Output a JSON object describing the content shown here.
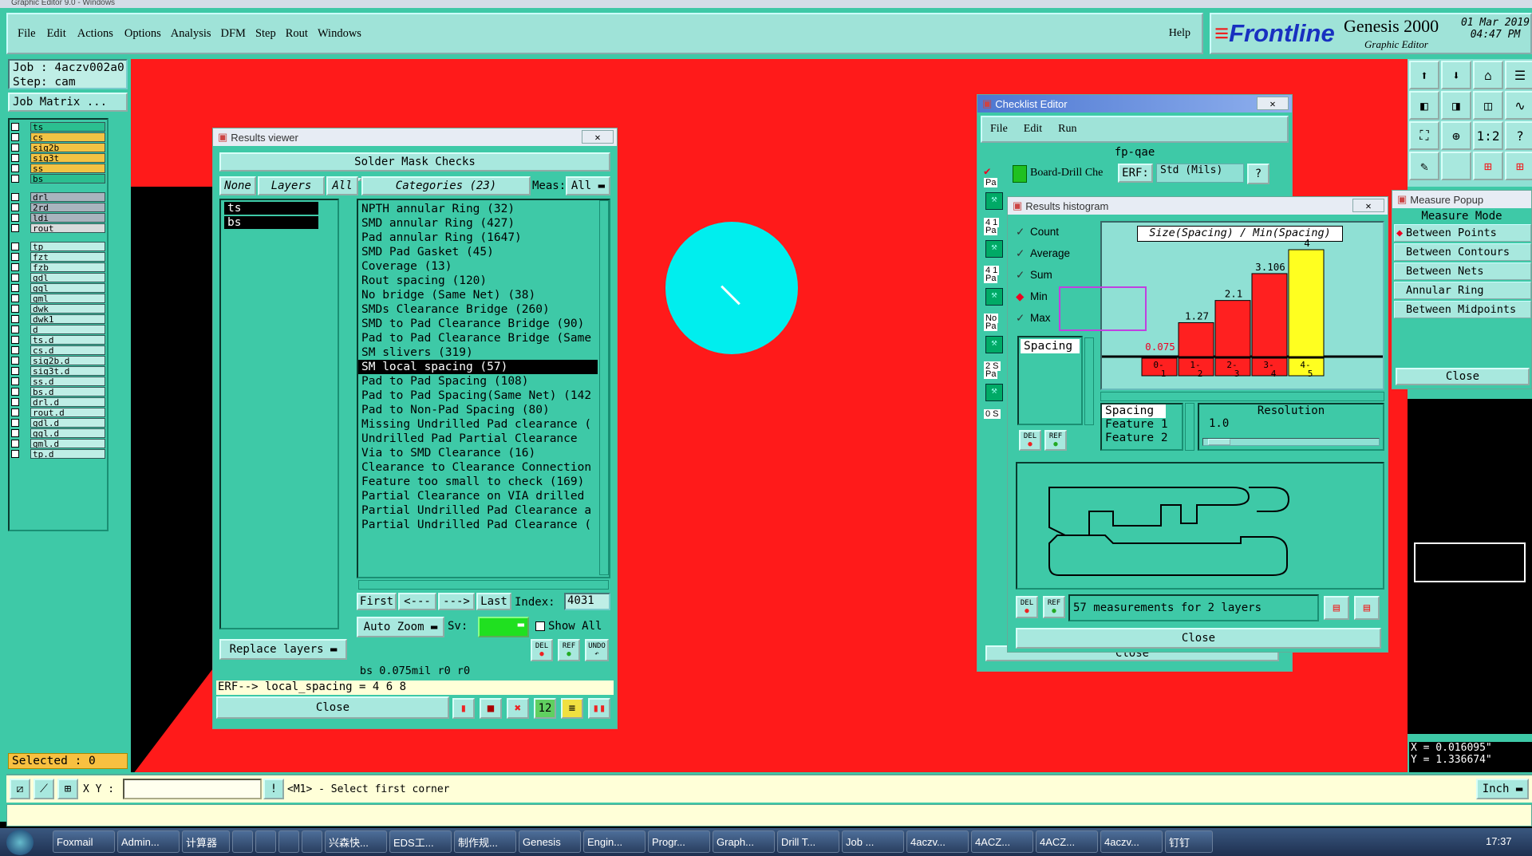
{
  "window": {
    "title": "Graphic Editor 9.0 - Windows"
  },
  "menu": {
    "items": [
      "File",
      "Edit",
      "Actions",
      "Options",
      "Analysis",
      "DFM",
      "Step",
      "Rout",
      "Windows"
    ],
    "help": "Help"
  },
  "brand": {
    "logo": "Frontline",
    "product": "Genesis 2000",
    "sub": "Graphic Editor",
    "date": "01 Mar 2019",
    "time": "04:47 PM"
  },
  "job": {
    "job_label": "Job : 4aczv002a0",
    "step_label": "Step: cam",
    "matrix_btn": "Job Matrix ..."
  },
  "layers": {
    "group1": [
      {
        "n": "ts",
        "c": "#2bbf90"
      },
      {
        "n": "cs",
        "c": "#f2c344"
      },
      {
        "n": "sig2b",
        "c": "#f2c344"
      },
      {
        "n": "sig3t",
        "c": "#f2c344"
      },
      {
        "n": "ss",
        "c": "#f2c344"
      },
      {
        "n": "bs",
        "c": "#2bbf90"
      }
    ],
    "group2": [
      {
        "n": "drl",
        "c": "#a9b4be"
      },
      {
        "n": "2rd",
        "c": "#a9b4be"
      },
      {
        "n": "ldi",
        "c": "#a9b4be"
      },
      {
        "n": "rout",
        "c": "#d8dcdc"
      }
    ],
    "group3": [
      "tp",
      "fzt",
      "fzb",
      "gdl",
      "ggl",
      "gml",
      "dwk",
      "dwk1",
      "d",
      "ts.d",
      "cs.d",
      "sig2b.d",
      "sig3t.d",
      "ss.d",
      "bs.d",
      "drl.d",
      "rout.d",
      "gdl.d",
      "ggl.d",
      "gml.d",
      "tp.d"
    ],
    "selected": "Selected : 0"
  },
  "results_viewer": {
    "title": "Results viewer",
    "section": "Solder Mask Checks",
    "none": "None",
    "layers": "Layers",
    "all": "All",
    "categories": "Categories (23)",
    "meas_label": "Meas:",
    "meas_value": "All",
    "layer_items": [
      "ts",
      "bs"
    ],
    "items": [
      "NPTH annular Ring (32)",
      "SMD annular Ring (427)",
      "Pad annular Ring (1647)",
      "SMD Pad Gasket (45)",
      "Coverage (13)",
      "Rout spacing (120)",
      "No bridge (Same Net) (38)",
      "SMDs Clearance Bridge (260)",
      "SMD to Pad Clearance Bridge (90)",
      "Pad to Pad Clearance Bridge (Same",
      "SM slivers (319)",
      "SM local spacing (57)",
      "Pad to Pad Spacing (108)",
      "Pad to Pad Spacing(Same Net) (142",
      "Pad to Non-Pad Spacing (80)",
      "Missing Undrilled Pad clearance (",
      "Undrilled Pad Partial Clearance",
      "Via to SMD Clearance (16)",
      "Clearance to Clearance Connection",
      "Feature too small to check (169)",
      "Partial Clearance on VIA drilled",
      "Partial Undrilled Pad Clearance a",
      "Partial Undrilled Pad Clearance ("
    ],
    "selected_index": 11,
    "first": "First",
    "prev": "<---",
    "next": "--->",
    "last": "Last",
    "index_label": "Index:",
    "index_value": "4031",
    "auto_zoom": "Auto Zoom",
    "sv": "Sv:",
    "show_all": "Show All",
    "replace_layers": "Replace layers",
    "del": "DEL",
    "ref": "REF",
    "undo": "UNDO",
    "status": "bs 0.075mil  r0  r0",
    "erf": "ERF--> local_spacing = 4 6 8",
    "close": "Close"
  },
  "checklist": {
    "title": "Checklist Editor",
    "menu": [
      "File",
      "Edit",
      "Run"
    ],
    "name": "fp-qae",
    "row1": "Board-Drill Che",
    "erf": "ERF:",
    "erf_value": "Std (Mils)",
    "close": "Close",
    "left_col": [
      "Pa",
      "4 1",
      "Pa",
      "4 1",
      "Pa",
      "No",
      "Pa",
      "2 S",
      "Pa",
      "0 S"
    ]
  },
  "histogram": {
    "title": "Results histogram",
    "options": [
      {
        "label": "Count",
        "kind": "check"
      },
      {
        "label": "Average",
        "kind": "check"
      },
      {
        "label": "Sum",
        "kind": "check"
      },
      {
        "label": "Min",
        "kind": "radio"
      },
      {
        "label": "Max",
        "kind": "check"
      }
    ],
    "list_item": "Spacing",
    "header": "Size(Spacing) / Min(Spacing)",
    "bins": [
      "0-1",
      "1-2",
      "2-3",
      "3-4",
      "4-5"
    ],
    "resolution_label": "Resolution",
    "resolution_value": "1.0",
    "fields": [
      "Spacing",
      "Feature 1",
      "Feature 2"
    ],
    "summary": "57 measurements for 2 layers",
    "close": "Close",
    "del": "DEL",
    "ref": "REF"
  },
  "chart_data": {
    "type": "bar",
    "categories": [
      "0-1",
      "1-2",
      "2-3",
      "3-4",
      "4-5"
    ],
    "values": [
      0.075,
      1.27,
      2.1,
      3.106,
      4
    ],
    "labels": [
      "0.075",
      "1.27",
      "2.1",
      "3.106",
      "4"
    ],
    "title": "Size(Spacing) / Min(Spacing)",
    "ylim": [
      0,
      4
    ],
    "colors": [
      "#ff2020",
      "#ff2020",
      "#ff2020",
      "#ff2020",
      "#ffff20"
    ]
  },
  "measure": {
    "title": "Measure Popup",
    "mode": "Measure Mode",
    "items": [
      "Between Points",
      "Between Contours",
      "Between Nets",
      "Annular Ring",
      "Between Midpoints"
    ],
    "close": "Close"
  },
  "coords": {
    "x": "X = 0.016095\"",
    "y": "Y = 1.336674\""
  },
  "statusbar": {
    "xy": "X Y :",
    "prompt": "<M1> - Select first corner",
    "unit": "Inch"
  },
  "taskbar": {
    "items": [
      "Foxmail",
      "Admin...",
      "计算器",
      "",
      "",
      "",
      "",
      "兴森快...",
      "EDS工...",
      "制作规...",
      "Genesis",
      "Engin...",
      "Progr...",
      "Graph...",
      "Drill T...",
      "Job ...",
      "4aczv...",
      "4ACZ...",
      "4ACZ...",
      "4aczv...",
      "钉钉"
    ],
    "clock": "17:37"
  },
  "colors": {
    "board": "#ff1a1a",
    "teal": "#3ec9a7",
    "panel": "#a8e8de",
    "cyan": "#00eeee"
  }
}
